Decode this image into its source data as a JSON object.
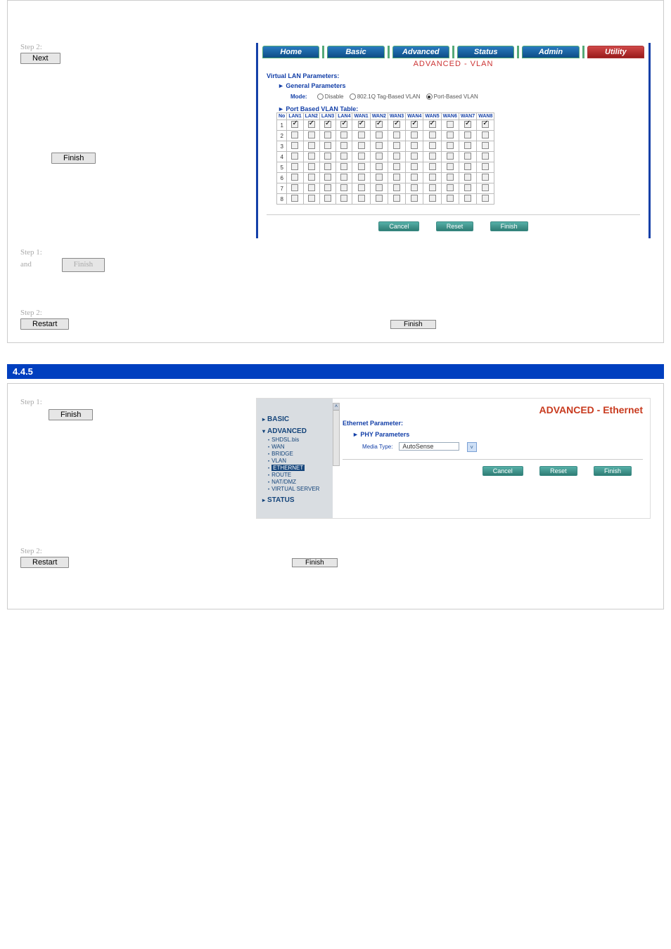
{
  "doc": {
    "step1a_label": "Step 2:",
    "step1a_btn": "Next",
    "step1b_btn": "Finish",
    "step2_label": "Step 1:",
    "step2_text1": "and ",
    "step2_btn": "Finish",
    "step3_label": "Step 2:",
    "step3_btn": "Restart",
    "step4_label": "Step 1:",
    "step4_btn1": "Finish",
    "step5_label": "Step 2:",
    "step5_btn": "Restart",
    "section_title": "4.4.5",
    "tiny_btn": "Finish"
  },
  "vlan": {
    "tabs": [
      "Home",
      "Basic",
      "Advanced",
      "Status",
      "Admin",
      "Utility"
    ],
    "subheader": "ADVANCED - VLAN",
    "heading": "Virtual LAN Parameters:",
    "gen_params": "General Parameters",
    "mode_label": "Mode:",
    "mode_opts": [
      "Disable",
      "802.1Q Tag-Based VLAN",
      "Port-Based VLAN"
    ],
    "mode_selected": 2,
    "pbvt": "Port Based VLAN Table:",
    "cols": [
      "No",
      "LAN1",
      "LAN2",
      "LAN3",
      "LAN4",
      "WAN1",
      "WAN2",
      "WAN3",
      "WAN4",
      "WAN5",
      "WAN6",
      "WAN7",
      "WAN8"
    ],
    "rows": [
      {
        "no": "1",
        "c": [
          true,
          true,
          true,
          true,
          true,
          true,
          true,
          true,
          true,
          false,
          true,
          true
        ]
      },
      {
        "no": "2",
        "c": [
          false,
          false,
          false,
          false,
          false,
          false,
          false,
          false,
          false,
          false,
          false,
          false
        ]
      },
      {
        "no": "3",
        "c": [
          false,
          false,
          false,
          false,
          false,
          false,
          false,
          false,
          false,
          false,
          false,
          false
        ]
      },
      {
        "no": "4",
        "c": [
          false,
          false,
          false,
          false,
          false,
          false,
          false,
          false,
          false,
          false,
          false,
          false
        ]
      },
      {
        "no": "5",
        "c": [
          false,
          false,
          false,
          false,
          false,
          false,
          false,
          false,
          false,
          false,
          false,
          false
        ]
      },
      {
        "no": "6",
        "c": [
          false,
          false,
          false,
          false,
          false,
          false,
          false,
          false,
          false,
          false,
          false,
          false
        ]
      },
      {
        "no": "7",
        "c": [
          false,
          false,
          false,
          false,
          false,
          false,
          false,
          false,
          false,
          false,
          false,
          false
        ]
      },
      {
        "no": "8",
        "c": [
          false,
          false,
          false,
          false,
          false,
          false,
          false,
          false,
          false,
          false,
          false,
          false
        ]
      }
    ],
    "btn_cancel": "Cancel",
    "btn_reset": "Reset",
    "btn_finish": "Finish"
  },
  "eth": {
    "nav_basic": "BASIC",
    "nav_adv": "ADVANCED",
    "nav_items": [
      "SHDSL.bis",
      "WAN",
      "BRIDGE",
      "VLAN",
      "ETHERNET",
      "ROUTE",
      "NAT/DMZ",
      "VIRTUAL SERVER"
    ],
    "nav_sel_index": 4,
    "nav_status": "STATUS",
    "title": "ADVANCED - Ethernet",
    "param_hdr": "Ethernet Parameter:",
    "phy_hdr": "PHY Parameters",
    "media_label": "Media Type:",
    "media_value": "AutoSense",
    "btn_cancel": "Cancel",
    "btn_reset": "Reset",
    "btn_finish": "Finish"
  }
}
